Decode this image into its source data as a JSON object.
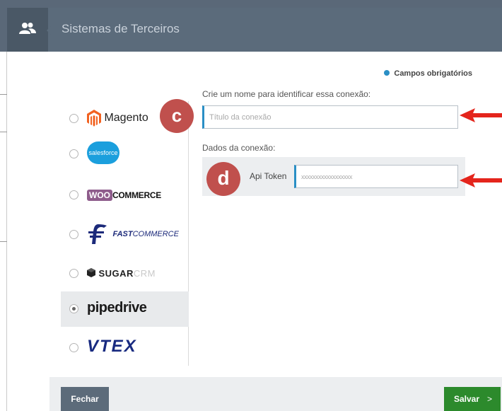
{
  "header": {
    "title": "Sistemas de Terceiros",
    "icon": "users-icon"
  },
  "required_note": "Campos obrigatórios",
  "colors": {
    "accent": "#2a8fc5",
    "save": "#2c8a2c",
    "header": "#5b6b7b",
    "badge": "#c0504d",
    "arrow": "#e4251c"
  },
  "systems": [
    {
      "name": "Magento",
      "logo_text": "Magento",
      "selected": false
    },
    {
      "name": "salesforce",
      "logo_text": "salesforce",
      "selected": false
    },
    {
      "name": "WooCommerce",
      "logo_box": "WOO",
      "logo_text": "COMMERCE",
      "selected": false
    },
    {
      "name": "FastCommerce",
      "logo_bold": "FAST",
      "logo_text": "COMMERCE",
      "selected": false
    },
    {
      "name": "SugarCRM",
      "logo_bold": "SUGAR",
      "logo_text": "CRM",
      "selected": false
    },
    {
      "name": "pipedrive",
      "logo_text": "pipedrive",
      "selected": true
    },
    {
      "name": "VTEX",
      "logo_text": "VTEX",
      "selected": false
    }
  ],
  "form": {
    "name_label": "Crie um nome para identificar essa conexão:",
    "name_placeholder": "Título da conexão",
    "name_value": "",
    "connection_label": "Dados da conexão:",
    "api_token_label": "Api Token",
    "api_token_value": "xxxxxxxxxxxxxxxxxx"
  },
  "annotations": {
    "badge_c": "c",
    "badge_d": "d"
  },
  "footer": {
    "close_label": "Fechar",
    "save_label": "Salvar",
    "save_icon": ">"
  }
}
